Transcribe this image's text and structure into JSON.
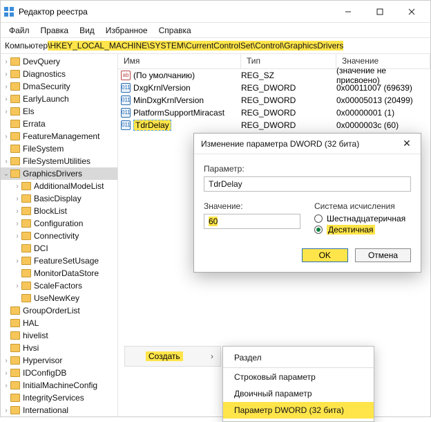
{
  "titlebar": {
    "title": "Редактор реестра"
  },
  "menubar": [
    "Файл",
    "Правка",
    "Вид",
    "Избранное",
    "Справка"
  ],
  "path": {
    "prefix": "Компьютер",
    "highlighted": "\\HKEY_LOCAL_MACHINE\\SYSTEM\\CurrentControlSet\\Control\\GraphicsDrivers"
  },
  "tree": [
    {
      "label": "DevQuery",
      "indent": 0,
      "caret": ">"
    },
    {
      "label": "Diagnostics",
      "indent": 0,
      "caret": ">"
    },
    {
      "label": "DmaSecurity",
      "indent": 0,
      "caret": ">"
    },
    {
      "label": "EarlyLaunch",
      "indent": 0,
      "caret": ">"
    },
    {
      "label": "Els",
      "indent": 0,
      "caret": ">"
    },
    {
      "label": "Errata",
      "indent": 0,
      "caret": ""
    },
    {
      "label": "FeatureManagement",
      "indent": 0,
      "caret": ">"
    },
    {
      "label": "FileSystem",
      "indent": 0,
      "caret": ""
    },
    {
      "label": "FileSystemUtilities",
      "indent": 0,
      "caret": ">"
    },
    {
      "label": "GraphicsDrivers",
      "indent": 0,
      "caret": "v",
      "selected": true
    },
    {
      "label": "AdditionalModeList",
      "indent": 1,
      "caret": ">"
    },
    {
      "label": "BasicDisplay",
      "indent": 1,
      "caret": ">"
    },
    {
      "label": "BlockList",
      "indent": 1,
      "caret": ">"
    },
    {
      "label": "Configuration",
      "indent": 1,
      "caret": ">"
    },
    {
      "label": "Connectivity",
      "indent": 1,
      "caret": ">"
    },
    {
      "label": "DCI",
      "indent": 1,
      "caret": ""
    },
    {
      "label": "FeatureSetUsage",
      "indent": 1,
      "caret": ">"
    },
    {
      "label": "MonitorDataStore",
      "indent": 1,
      "caret": ""
    },
    {
      "label": "ScaleFactors",
      "indent": 1,
      "caret": ">"
    },
    {
      "label": "UseNewKey",
      "indent": 1,
      "caret": ""
    },
    {
      "label": "GroupOrderList",
      "indent": 0,
      "caret": ""
    },
    {
      "label": "HAL",
      "indent": 0,
      "caret": ""
    },
    {
      "label": "hivelist",
      "indent": 0,
      "caret": ""
    },
    {
      "label": "Hvsi",
      "indent": 0,
      "caret": ""
    },
    {
      "label": "Hypervisor",
      "indent": 0,
      "caret": ">"
    },
    {
      "label": "IDConfigDB",
      "indent": 0,
      "caret": ">"
    },
    {
      "label": "InitialMachineConfig",
      "indent": 0,
      "caret": ">"
    },
    {
      "label": "IntegrityServices",
      "indent": 0,
      "caret": ""
    },
    {
      "label": "International",
      "indent": 0,
      "caret": ">"
    }
  ],
  "columns": {
    "name": "Имя",
    "type": "Тип",
    "value": "Значение"
  },
  "rows": [
    {
      "icon": "sz",
      "name": "(По умолчанию)",
      "type": "REG_SZ",
      "value": "(значение не присвоено)"
    },
    {
      "icon": "dw",
      "name": "DxgKrnlVersion",
      "type": "REG_DWORD",
      "value": "0x00011007 (69639)"
    },
    {
      "icon": "dw",
      "name": "MinDxgKrnlVersion",
      "type": "REG_DWORD",
      "value": "0x00005013 (20499)"
    },
    {
      "icon": "dw",
      "name": "PlatformSupportMiracast",
      "type": "REG_DWORD",
      "value": "0x00000001 (1)"
    },
    {
      "icon": "dw",
      "name": "TdrDelay",
      "type": "REG_DWORD",
      "value": "0x0000003c (60)",
      "hl": true
    }
  ],
  "dialog": {
    "title": "Изменение параметра DWORD (32 бита)",
    "param_label": "Параметр:",
    "param_value": "TdrDelay",
    "value_label": "Значение:",
    "value_value": "60",
    "base_label": "Система исчисления",
    "radio_hex": "Шестнадцатеричная",
    "radio_dec": "Десятичная",
    "ok": "OK",
    "cancel": "Отмена"
  },
  "context": {
    "create": "Создать",
    "items": [
      "Раздел",
      "Строковый параметр",
      "Двоичный параметр",
      "Параметр DWORD (32 бита)"
    ]
  }
}
